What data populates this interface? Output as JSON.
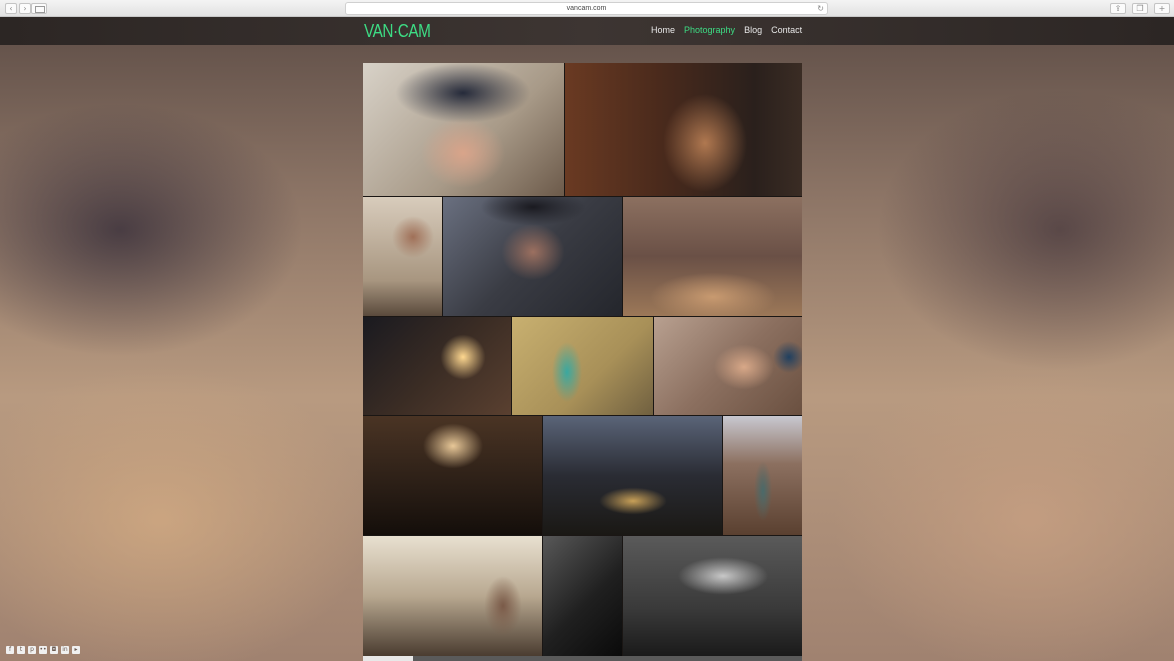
{
  "browser": {
    "url": "vancam.com",
    "back_glyph": "‹",
    "forward_glyph": "›",
    "reload_glyph": "↻",
    "share_glyph": "⇪",
    "tabs_glyph": "❐",
    "newtab_glyph": "+"
  },
  "site": {
    "logo": "VAN·CAM",
    "nav": {
      "home": "Home",
      "photography": "Photography",
      "blog": "Blog",
      "contact": "Contact"
    },
    "accent_color": "#3ddc84"
  },
  "social": [
    {
      "icon": "facebook-icon",
      "glyph": "f"
    },
    {
      "icon": "twitter-icon",
      "glyph": "t"
    },
    {
      "icon": "pinterest-icon",
      "glyph": "p"
    },
    {
      "icon": "flickr-icon",
      "glyph": "••"
    },
    {
      "icon": "instagram-icon",
      "glyph": "◘"
    },
    {
      "icon": "linkedin-icon",
      "glyph": "in"
    },
    {
      "icon": "vimeo-icon",
      "glyph": "▸"
    }
  ]
}
